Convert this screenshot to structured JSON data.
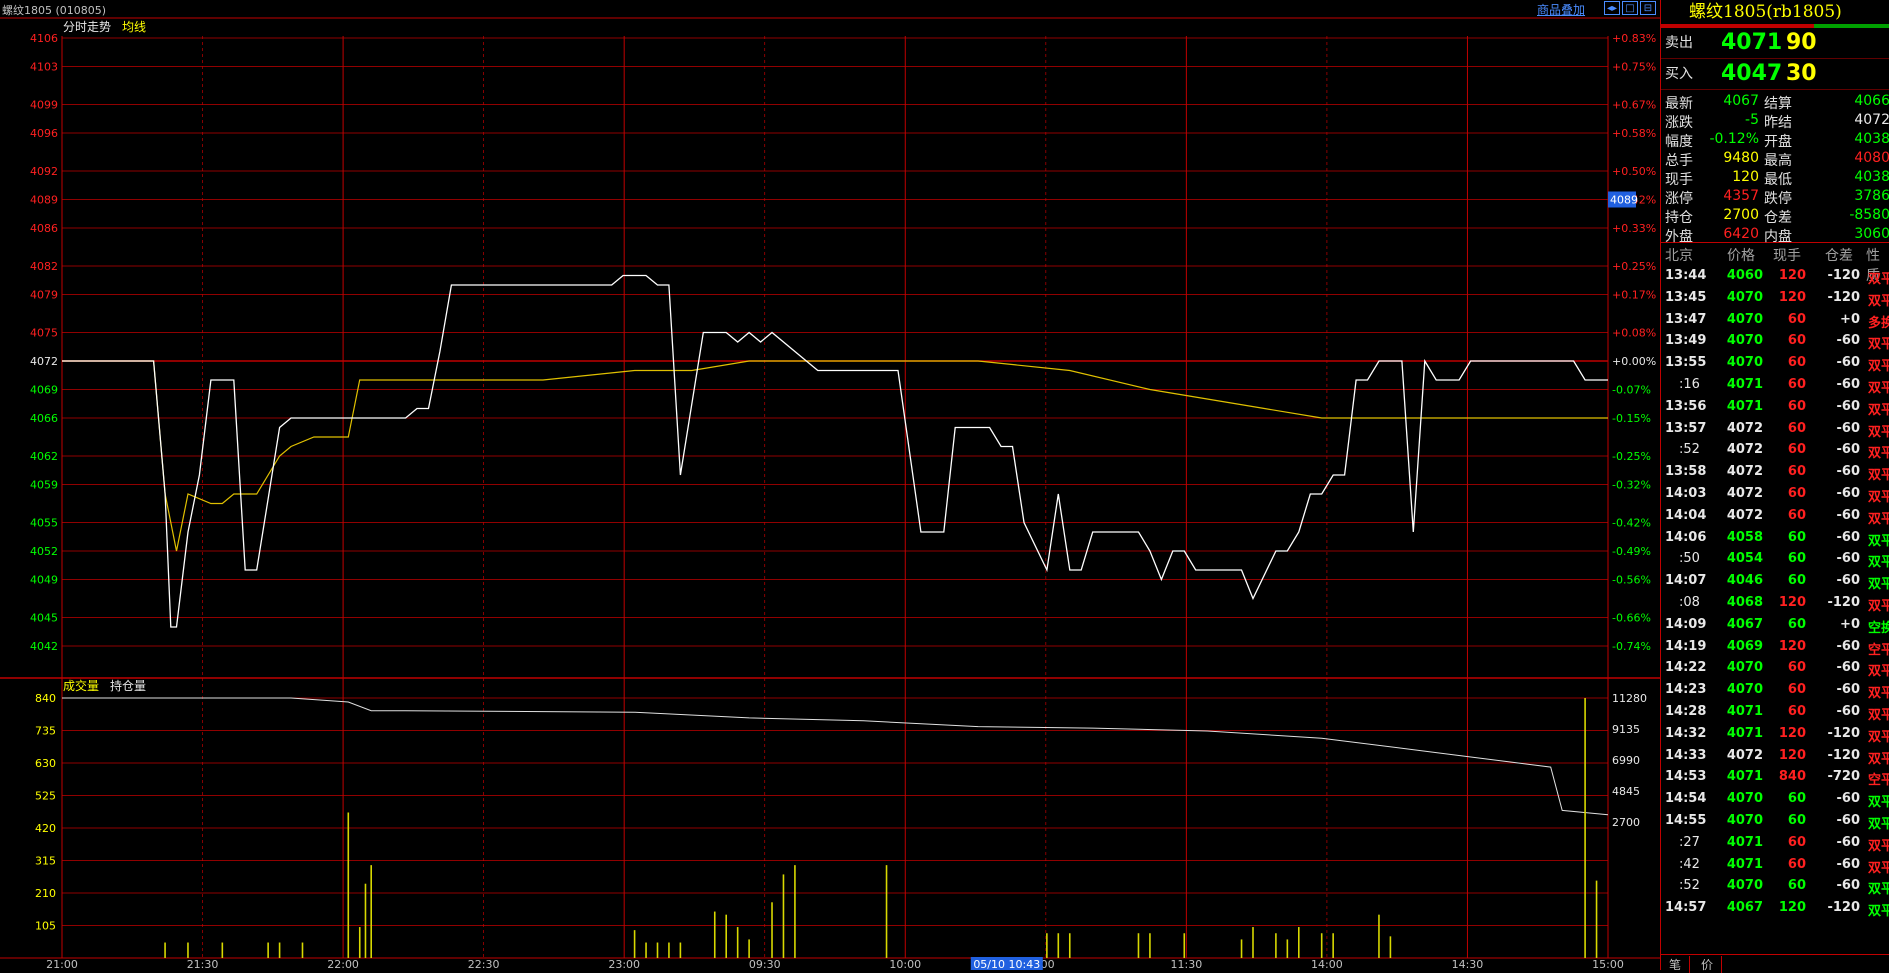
{
  "title": "螺纹1805 (010805)",
  "overlay_link": "商品叠加",
  "window_buttons": [
    "◂▸",
    "□",
    "⊟"
  ],
  "colors": {
    "up": "#ff2020",
    "down": "#00ff00",
    "flat": "#e8e8e8",
    "price_line": "#ffffff",
    "avg_line": "#e0c000",
    "grid": "#c00000",
    "volume": "#d8d800",
    "oi_line": "#e0e0e0"
  },
  "price_chart": {
    "label_main": "分时走势",
    "label_avg": "均线",
    "prev_settle": 4072,
    "y_ticks": [
      "4106",
      "4103",
      "4099",
      "4096",
      "4092",
      "4089",
      "4086",
      "4082",
      "4079",
      "4075",
      "4072",
      "4069",
      "4066",
      "4062",
      "4059",
      "4055",
      "4052",
      "4049",
      "4045",
      "4042"
    ],
    "pct_ticks": [
      "+0.83%",
      "+0.75%",
      "+0.67%",
      "+0.58%",
      "+0.50%",
      "+0.42%",
      "+0.33%",
      "+0.25%",
      "+0.17%",
      "+0.08%",
      "+0.00%",
      "-0.07%",
      "-0.15%",
      "-0.25%",
      "-0.32%",
      "-0.42%",
      "-0.49%",
      "-0.56%",
      "-0.66%",
      "-0.74%"
    ],
    "cursor_value": "4089"
  },
  "volume_chart": {
    "label_vol": "成交量",
    "label_oi": "持仓量",
    "left_ticks": [
      "840",
      "735",
      "630",
      "525",
      "420",
      "315",
      "210",
      "105"
    ],
    "right_ticks": [
      "11280",
      "9135",
      "6990",
      "4845",
      "2700"
    ]
  },
  "time_axis": [
    "21:00",
    "21:30",
    "22:00",
    "22:30",
    "23:00",
    "09:30",
    "10:00",
    ":00",
    "11:30",
    "14:00",
    "14:30",
    "15:00"
  ],
  "cursor_time": "05/10 10:43",
  "chart_data": {
    "type": "line",
    "series": [
      {
        "name": "分时走势",
        "x": [
          0,
          8,
          9,
          9.5,
          10,
          11,
          12,
          13,
          15,
          16,
          17,
          19,
          20,
          30,
          31,
          32,
          33,
          34,
          47,
          48,
          49,
          51,
          52,
          53,
          54,
          56,
          58,
          59,
          60,
          61,
          62,
          66,
          67,
          68,
          70,
          72,
          73,
          75,
          76,
          77,
          78,
          81,
          82,
          83,
          84,
          86,
          87,
          88,
          89,
          90,
          94,
          95,
          96,
          97,
          98,
          99,
          100,
          101,
          102,
          103,
          104,
          106,
          107,
          108,
          109,
          110,
          111,
          112,
          113,
          114,
          115,
          116,
          117,
          118,
          119,
          120,
          121,
          122,
          123,
          125,
          126,
          127,
          129,
          130,
          131,
          132,
          133,
          135
        ],
        "values": [
          4072,
          4072,
          4058,
          4044,
          4044,
          4054,
          4060,
          4070,
          4070,
          4050,
          4050,
          4065,
          4066,
          4066,
          4067,
          4067,
          4073,
          4080,
          4080,
          4080,
          4081,
          4081,
          4080,
          4080,
          4060,
          4075,
          4075,
          4074,
          4075,
          4074,
          4075,
          4071,
          4071,
          4071,
          4071,
          4071,
          4071,
          4054,
          4054,
          4054,
          4065,
          4065,
          4063,
          4063,
          4055,
          4050,
          4058,
          4050,
          4050,
          4054,
          4054,
          4052,
          4049,
          4052,
          4052,
          4050,
          4050,
          4050,
          4050,
          4050,
          4047,
          4052,
          4052,
          4054,
          4058,
          4058,
          4060,
          4060,
          4070,
          4070,
          4072,
          4072,
          4072,
          4054,
          4072,
          4070,
          4070,
          4070,
          4072,
          4072,
          4072,
          4072,
          4072,
          4072,
          4072,
          4072,
          4070,
          4070
        ]
      },
      {
        "name": "均线",
        "x": [
          0,
          8,
          9,
          10,
          11,
          13,
          14,
          15,
          17,
          19,
          20,
          22,
          25,
          26,
          34,
          36,
          42,
          50,
          55,
          60,
          70,
          75,
          80,
          88,
          95,
          100,
          105,
          110,
          115,
          120,
          125,
          130,
          135
        ],
        "values": [
          4072,
          4072,
          4058,
          4052,
          4058,
          4057,
          4057,
          4058,
          4058,
          4062,
          4063,
          4064,
          4064,
          4070,
          4070,
          4070,
          4070,
          4071,
          4071,
          4072,
          4072,
          4072,
          4072,
          4071,
          4069,
          4068,
          4067,
          4066,
          4066,
          4066,
          4066,
          4066,
          4066
        ]
      }
    ],
    "volume": {
      "x": [
        9,
        11,
        14,
        18,
        19,
        21,
        25,
        26,
        26.5,
        27,
        50,
        51,
        52,
        53,
        54,
        57,
        58,
        59,
        60,
        62,
        63,
        64,
        72,
        86,
        87,
        88,
        94,
        95,
        98,
        103,
        104,
        106,
        107,
        108,
        110,
        111,
        115,
        116,
        133,
        134
      ],
      "values": [
        50,
        50,
        50,
        50,
        50,
        50,
        470,
        100,
        240,
        300,
        90,
        50,
        50,
        50,
        50,
        150,
        140,
        100,
        60,
        180,
        270,
        300,
        300,
        80,
        80,
        80,
        80,
        80,
        80,
        60,
        100,
        80,
        60,
        100,
        80,
        80,
        140,
        70,
        840,
        250
      ]
    },
    "open_interest": {
      "x": [
        0,
        20,
        25,
        27,
        30,
        50,
        60,
        70,
        80,
        90,
        100,
        110,
        120,
        130,
        131,
        135
      ],
      "values": [
        11280,
        11280,
        11000,
        10400,
        10400,
        10300,
        9900,
        9700,
        9300,
        9200,
        9000,
        8500,
        7500,
        6500,
        3500,
        3200
      ]
    }
  },
  "quote": {
    "name": "螺纹1805(rb1805)",
    "sell_label": "卖出",
    "sell_price": "4071",
    "sell_vol": "90",
    "buy_label": "买入",
    "buy_price": "4047",
    "buy_vol": "30",
    "rows": [
      {
        "k1": "最新",
        "v1": "4067",
        "c1": "down",
        "k2": "结算",
        "v2": "4066",
        "c2": "down"
      },
      {
        "k1": "涨跌",
        "v1": "-5",
        "c1": "down",
        "k2": "昨结",
        "v2": "4072",
        "c2": "flat"
      },
      {
        "k1": "幅度",
        "v1": "-0.12%",
        "c1": "down",
        "k2": "开盘",
        "v2": "4038",
        "c2": "down"
      },
      {
        "k1": "总手",
        "v1": "9480",
        "c1": "vol",
        "k2": "最高",
        "v2": "4080",
        "c2": "up"
      },
      {
        "k1": "现手",
        "v1": "120",
        "c1": "vol",
        "k2": "最低",
        "v2": "4038",
        "c2": "down"
      },
      {
        "k1": "涨停",
        "v1": "4357",
        "c1": "up",
        "k2": "跌停",
        "v2": "3786",
        "c2": "down"
      },
      {
        "k1": "持仓",
        "v1": "2700",
        "c1": "vol",
        "k2": "仓差",
        "v2": "-8580",
        "c2": "down"
      },
      {
        "k1": "外盘",
        "v1": "6420",
        "c1": "up",
        "k2": "内盘",
        "v2": "3060",
        "c2": "down"
      }
    ],
    "ticks_header": [
      "北京",
      "价格",
      "现手",
      "仓差",
      "性质"
    ],
    "ticks": [
      {
        "t": "13:44",
        "p": "4060",
        "pc": "down",
        "v": "120",
        "vc": "up",
        "d": "-120",
        "n": "双平",
        "nc": "up"
      },
      {
        "t": "13:45",
        "p": "4070",
        "pc": "down",
        "v": "120",
        "vc": "up",
        "d": "-120",
        "n": "双平",
        "nc": "up"
      },
      {
        "t": "13:47",
        "p": "4070",
        "pc": "down",
        "v": "60",
        "vc": "up",
        "d": "+0",
        "n": "多换",
        "nc": "up"
      },
      {
        "t": "13:49",
        "p": "4070",
        "pc": "down",
        "v": "60",
        "vc": "up",
        "d": "-60",
        "n": "双平",
        "nc": "up"
      },
      {
        "t": "13:55",
        "p": "4070",
        "pc": "down",
        "v": "60",
        "vc": "up",
        "d": "-60",
        "n": "双平",
        "nc": "up"
      },
      {
        "t": ":16",
        "p": "4071",
        "pc": "down",
        "v": "60",
        "vc": "up",
        "d": "-60",
        "n": "双平",
        "nc": "up"
      },
      {
        "t": "13:56",
        "p": "4071",
        "pc": "down",
        "v": "60",
        "vc": "up",
        "d": "-60",
        "n": "双平",
        "nc": "up"
      },
      {
        "t": "13:57",
        "p": "4072",
        "pc": "flat",
        "v": "60",
        "vc": "up",
        "d": "-60",
        "n": "双平",
        "nc": "up"
      },
      {
        "t": ":52",
        "p": "4072",
        "pc": "flat",
        "v": "60",
        "vc": "up",
        "d": "-60",
        "n": "双平",
        "nc": "up"
      },
      {
        "t": "13:58",
        "p": "4072",
        "pc": "flat",
        "v": "60",
        "vc": "up",
        "d": "-60",
        "n": "双平",
        "nc": "up"
      },
      {
        "t": "14:03",
        "p": "4072",
        "pc": "flat",
        "v": "60",
        "vc": "up",
        "d": "-60",
        "n": "双平",
        "nc": "up"
      },
      {
        "t": "14:04",
        "p": "4072",
        "pc": "flat",
        "v": "60",
        "vc": "up",
        "d": "-60",
        "n": "双平",
        "nc": "up"
      },
      {
        "t": "14:06",
        "p": "4058",
        "pc": "down",
        "v": "60",
        "vc": "down",
        "d": "-60",
        "n": "双平",
        "nc": "down"
      },
      {
        "t": ":50",
        "p": "4054",
        "pc": "down",
        "v": "60",
        "vc": "down",
        "d": "-60",
        "n": "双平",
        "nc": "down"
      },
      {
        "t": "14:07",
        "p": "4046",
        "pc": "down",
        "v": "60",
        "vc": "down",
        "d": "-60",
        "n": "双平",
        "nc": "down"
      },
      {
        "t": ":08",
        "p": "4068",
        "pc": "down",
        "v": "120",
        "vc": "up",
        "d": "-120",
        "n": "双平",
        "nc": "up"
      },
      {
        "t": "14:09",
        "p": "4067",
        "pc": "down",
        "v": "60",
        "vc": "down",
        "d": "+0",
        "n": "空换",
        "nc": "down"
      },
      {
        "t": "14:19",
        "p": "4069",
        "pc": "down",
        "v": "120",
        "vc": "up",
        "d": "-60",
        "n": "空平",
        "nc": "up"
      },
      {
        "t": "14:22",
        "p": "4070",
        "pc": "down",
        "v": "60",
        "vc": "up",
        "d": "-60",
        "n": "双平",
        "nc": "up"
      },
      {
        "t": "14:23",
        "p": "4070",
        "pc": "down",
        "v": "60",
        "vc": "up",
        "d": "-60",
        "n": "双平",
        "nc": "up"
      },
      {
        "t": "14:28",
        "p": "4071",
        "pc": "down",
        "v": "60",
        "vc": "up",
        "d": "-60",
        "n": "双平",
        "nc": "up"
      },
      {
        "t": "14:32",
        "p": "4071",
        "pc": "down",
        "v": "120",
        "vc": "up",
        "d": "-120",
        "n": "双平",
        "nc": "up"
      },
      {
        "t": "14:33",
        "p": "4072",
        "pc": "flat",
        "v": "120",
        "vc": "up",
        "d": "-120",
        "n": "双平",
        "nc": "up"
      },
      {
        "t": "14:53",
        "p": "4071",
        "pc": "down",
        "v": "840",
        "vc": "up",
        "d": "-720",
        "n": "空平",
        "nc": "up"
      },
      {
        "t": "14:54",
        "p": "4070",
        "pc": "down",
        "v": "60",
        "vc": "down",
        "d": "-60",
        "n": "双平",
        "nc": "down"
      },
      {
        "t": "14:55",
        "p": "4070",
        "pc": "down",
        "v": "60",
        "vc": "down",
        "d": "-60",
        "n": "双平",
        "nc": "down"
      },
      {
        "t": ":27",
        "p": "4071",
        "pc": "down",
        "v": "60",
        "vc": "up",
        "d": "-60",
        "n": "双平",
        "nc": "up"
      },
      {
        "t": ":42",
        "p": "4071",
        "pc": "down",
        "v": "60",
        "vc": "up",
        "d": "-60",
        "n": "双平",
        "nc": "up"
      },
      {
        "t": ":52",
        "p": "4070",
        "pc": "down",
        "v": "60",
        "vc": "down",
        "d": "-60",
        "n": "双平",
        "nc": "down"
      },
      {
        "t": "14:57",
        "p": "4067",
        "pc": "down",
        "v": "120",
        "vc": "down",
        "d": "-120",
        "n": "双平",
        "nc": "down"
      }
    ],
    "tabs": [
      "笔",
      "价"
    ]
  }
}
